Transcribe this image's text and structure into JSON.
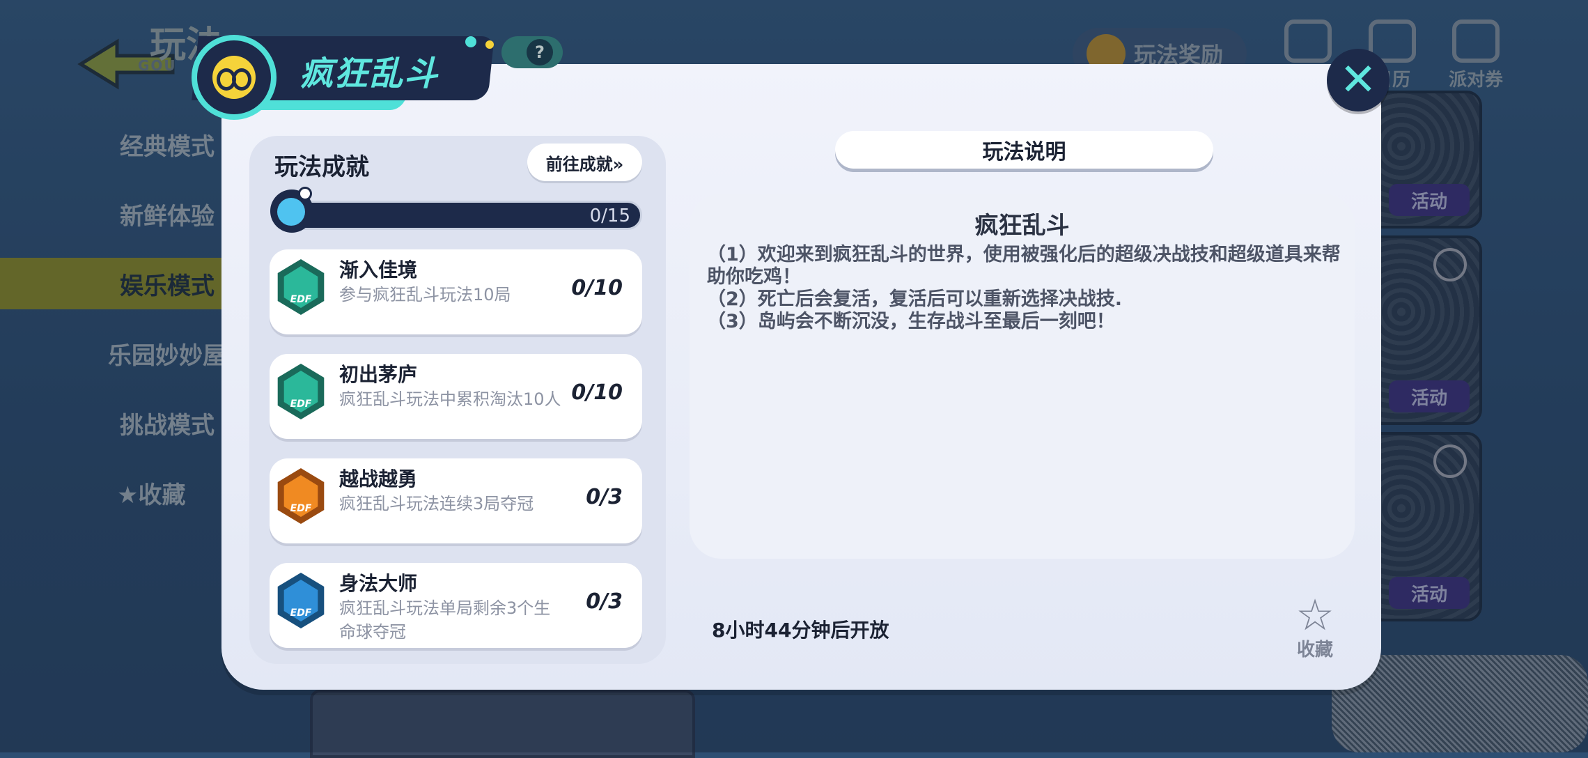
{
  "background": {
    "page_title": "玩法",
    "page_title_sub": "GOU",
    "side_items": [
      "经典模式",
      "新鲜体验",
      "娱乐模式",
      "乐园妙妙屋",
      "挑战模式",
      "收藏"
    ],
    "fav_star": "★",
    "top_reward_label": "玩法奖励",
    "top_icons": [
      "",
      "日历",
      "派对券"
    ],
    "card_tags": [
      "活动",
      "活动",
      "活动"
    ]
  },
  "modal": {
    "title": "疯狂乱斗",
    "help_symbol": "?",
    "close_symbol": "✕",
    "achievements": {
      "title": "玩法成就",
      "goto_label": "前往成就»",
      "progress_text": "0/15",
      "progress_value": 0,
      "items": [
        {
          "name": "渐入佳境",
          "desc": "参与疯狂乱斗玩法10局",
          "count": "0/10",
          "badge_color": "teal",
          "badge_label": "EDF"
        },
        {
          "name": "初出茅庐",
          "desc": "疯狂乱斗玩法中累积淘汰10人",
          "count": "0/10",
          "badge_color": "teal",
          "badge_label": "EDF"
        },
        {
          "name": "越战越勇",
          "desc": "疯狂乱斗玩法连续3局夺冠",
          "count": "0/3",
          "badge_color": "orange",
          "badge_label": "EDF"
        },
        {
          "name": "身法大师",
          "desc": "疯狂乱斗玩法单局剩余3个生命球夺冠",
          "count": "0/3",
          "badge_color": "blue",
          "badge_label": "EDF"
        }
      ]
    },
    "rules": {
      "header": "玩法说明",
      "title": "疯狂乱斗",
      "lines": [
        "（1）欢迎来到疯狂乱斗的世界，使用被强化后的超级决战技和超级道具来帮助你吃鸡！",
        "（2）死亡后会复活，复活后可以重新选择决战技.",
        "（3）岛屿会不断沉没，生存战斗至最后一刻吧！"
      ]
    },
    "open_time": "8小时44分钟后开放",
    "favorite_label": "收藏",
    "favorite_icon": "☆"
  },
  "colors": {
    "navy": "#1d2a4a",
    "teal": "#4fe0d8",
    "active_tab": "#8e8a22",
    "badge_teal": "#2bb89a",
    "badge_orange": "#f08a22",
    "badge_blue": "#2f8fd8"
  }
}
